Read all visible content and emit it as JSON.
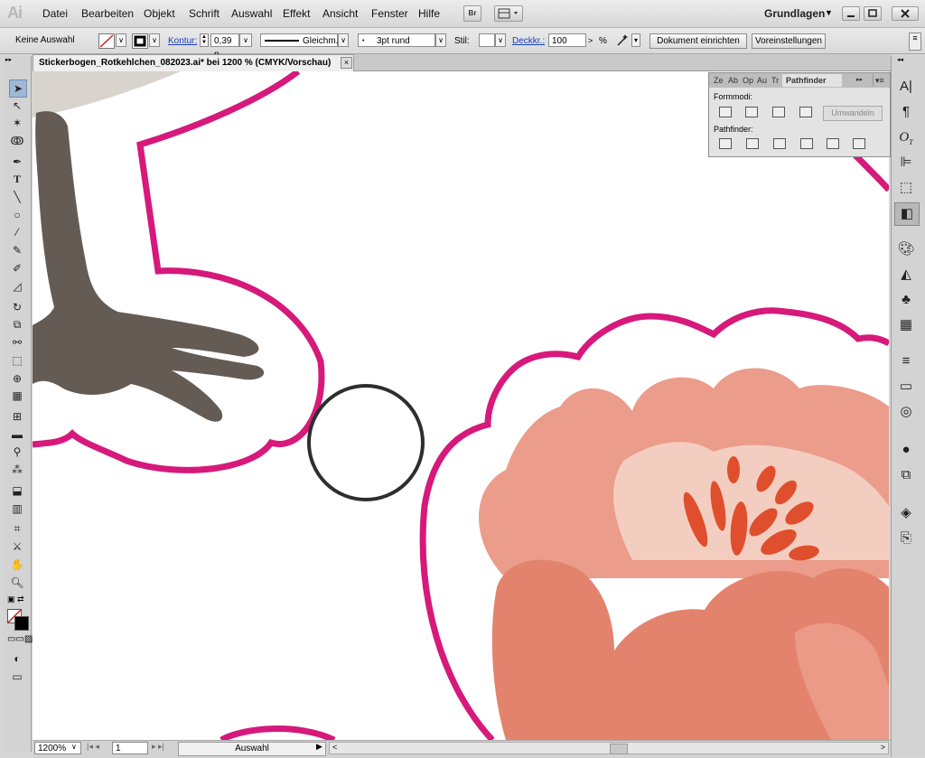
{
  "app": {
    "logo": "Ai"
  },
  "menu": [
    "Datei",
    "Bearbeiten",
    "Objekt",
    "Schrift",
    "Auswahl",
    "Effekt",
    "Ansicht",
    "Fenster",
    "Hilfe"
  ],
  "topbar": {
    "bridge_label": "Br",
    "workspace": "Grundlagen"
  },
  "control": {
    "selection": "Keine Auswahl",
    "kontur_label": "Kontur:",
    "kontur_value": "0,39 p",
    "stroke_profile": "Gleichm.",
    "brush": "3pt rund",
    "stil_label": "Stil:",
    "deckkraft_label": "Deckkr.:",
    "deckkraft_value": "100",
    "percent": "%",
    "doc_setup": "Dokument einrichten",
    "preferences": "Voreinstellungen"
  },
  "document": {
    "tab_title": "Stickerbogen_Rotkehlchen_082023.ai* bei 1200 % (CMYK/Vorschau)"
  },
  "pathfinder": {
    "tabs": [
      "Ze",
      "Ab",
      "Op",
      "Au",
      "Tr"
    ],
    "active_tab": "Pathfinder",
    "formmodi": "Formmodi:",
    "umwandeln": "Umwandeln",
    "pathfinder_label": "Pathfinder:"
  },
  "status": {
    "zoom": "1200%",
    "artboard": "1",
    "mode": "Auswahl"
  },
  "colors": {
    "magenta": "#d6197b",
    "robin_legs": "#645c54",
    "petal_light": "#ec9c8a",
    "petal_dark": "#e3836d",
    "stamen": "#df4f2d",
    "circle": "#2e2e2e"
  }
}
